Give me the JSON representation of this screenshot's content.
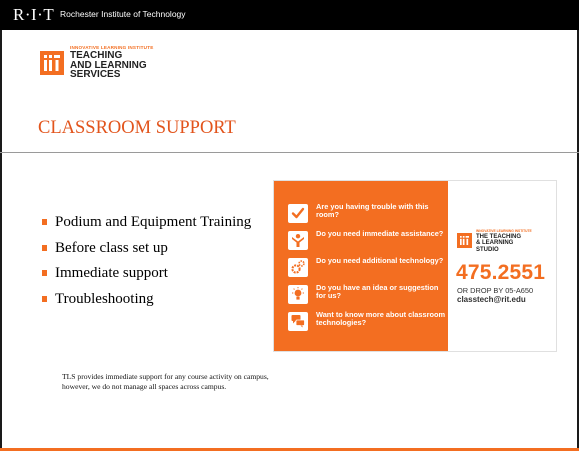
{
  "header": {
    "rit_mark": "R·I·T",
    "rit_name": "Rochester Institute of Technology"
  },
  "logo": {
    "institute": "INNOVATIVE LEARNING INSTITUTE",
    "line1": "TEACHING",
    "line2": "AND LEARNING",
    "line3": "SERVICES"
  },
  "slide": {
    "title": "CLASSROOM SUPPORT",
    "bullets": [
      "Podium and Equipment Training",
      "Before class set up",
      "Immediate support",
      "Troubleshooting"
    ],
    "footnote": "TLS provides immediate support for any course activity on campus, however, we do not manage all spaces across campus."
  },
  "card": {
    "questions": [
      {
        "icon": "checkmark-icon",
        "text": "Are you having trouble with this room?"
      },
      {
        "icon": "person-icon",
        "text": "Do you need immediate assistance?"
      },
      {
        "icon": "gears-icon",
        "text": "Do you need additional technology?"
      },
      {
        "icon": "lightbulb-icon",
        "text": "Do you have an idea or suggestion for us?"
      },
      {
        "icon": "speech-bubbles-icon",
        "text": "Want to know more about classroom technologies?"
      }
    ],
    "studio": {
      "institute": "INNOVATIVE LEARNING INSTITUTE",
      "line1": "THE TEACHING",
      "line2": "& LEARNING",
      "line3": "STUDIO"
    },
    "phone": "475.2551",
    "drop_by": "OR DROP BY 05-A650",
    "email": "classtech@rit.edu"
  },
  "colors": {
    "accent": "#f36e21",
    "title": "#e2541c",
    "header_bg": "#000000"
  }
}
